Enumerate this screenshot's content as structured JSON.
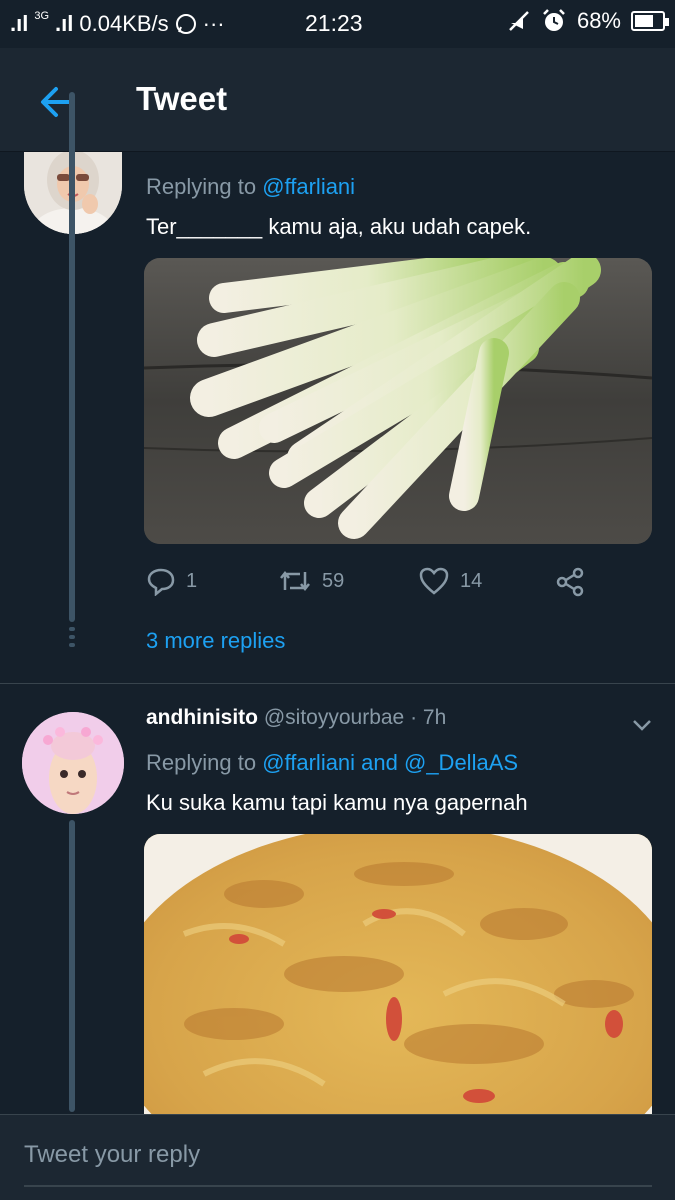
{
  "status_bar": {
    "signal": ".ıl",
    "network": "3G",
    "network_signal": ".ıl",
    "speed": "0.04KB/s",
    "more": "···",
    "time": "21:23",
    "battery": "68%",
    "battery_level": 0.68
  },
  "header": {
    "title": "Tweet"
  },
  "tweets": [
    {
      "replying_prefix": "Replying to",
      "replying_to": "@ffarliani",
      "text": "Ter_______ kamu aja, aku udah capek.",
      "actions": {
        "replies": "1",
        "retweets": "59",
        "likes": "14"
      },
      "more_replies": "3 more replies"
    },
    {
      "name": "andhinisito",
      "handle": "@sitoyyourbae",
      "separator": "·",
      "time": "7h",
      "replying_prefix": "Replying to",
      "replying_to": "@ffarliani and @_DellaAS",
      "text": "Ku suka kamu tapi kamu nya gapernah"
    }
  ],
  "composer": {
    "placeholder": "Tweet your reply"
  },
  "colors": {
    "background": "#15202b",
    "accent": "#1da1f2",
    "secondary_text": "#8899a6"
  }
}
